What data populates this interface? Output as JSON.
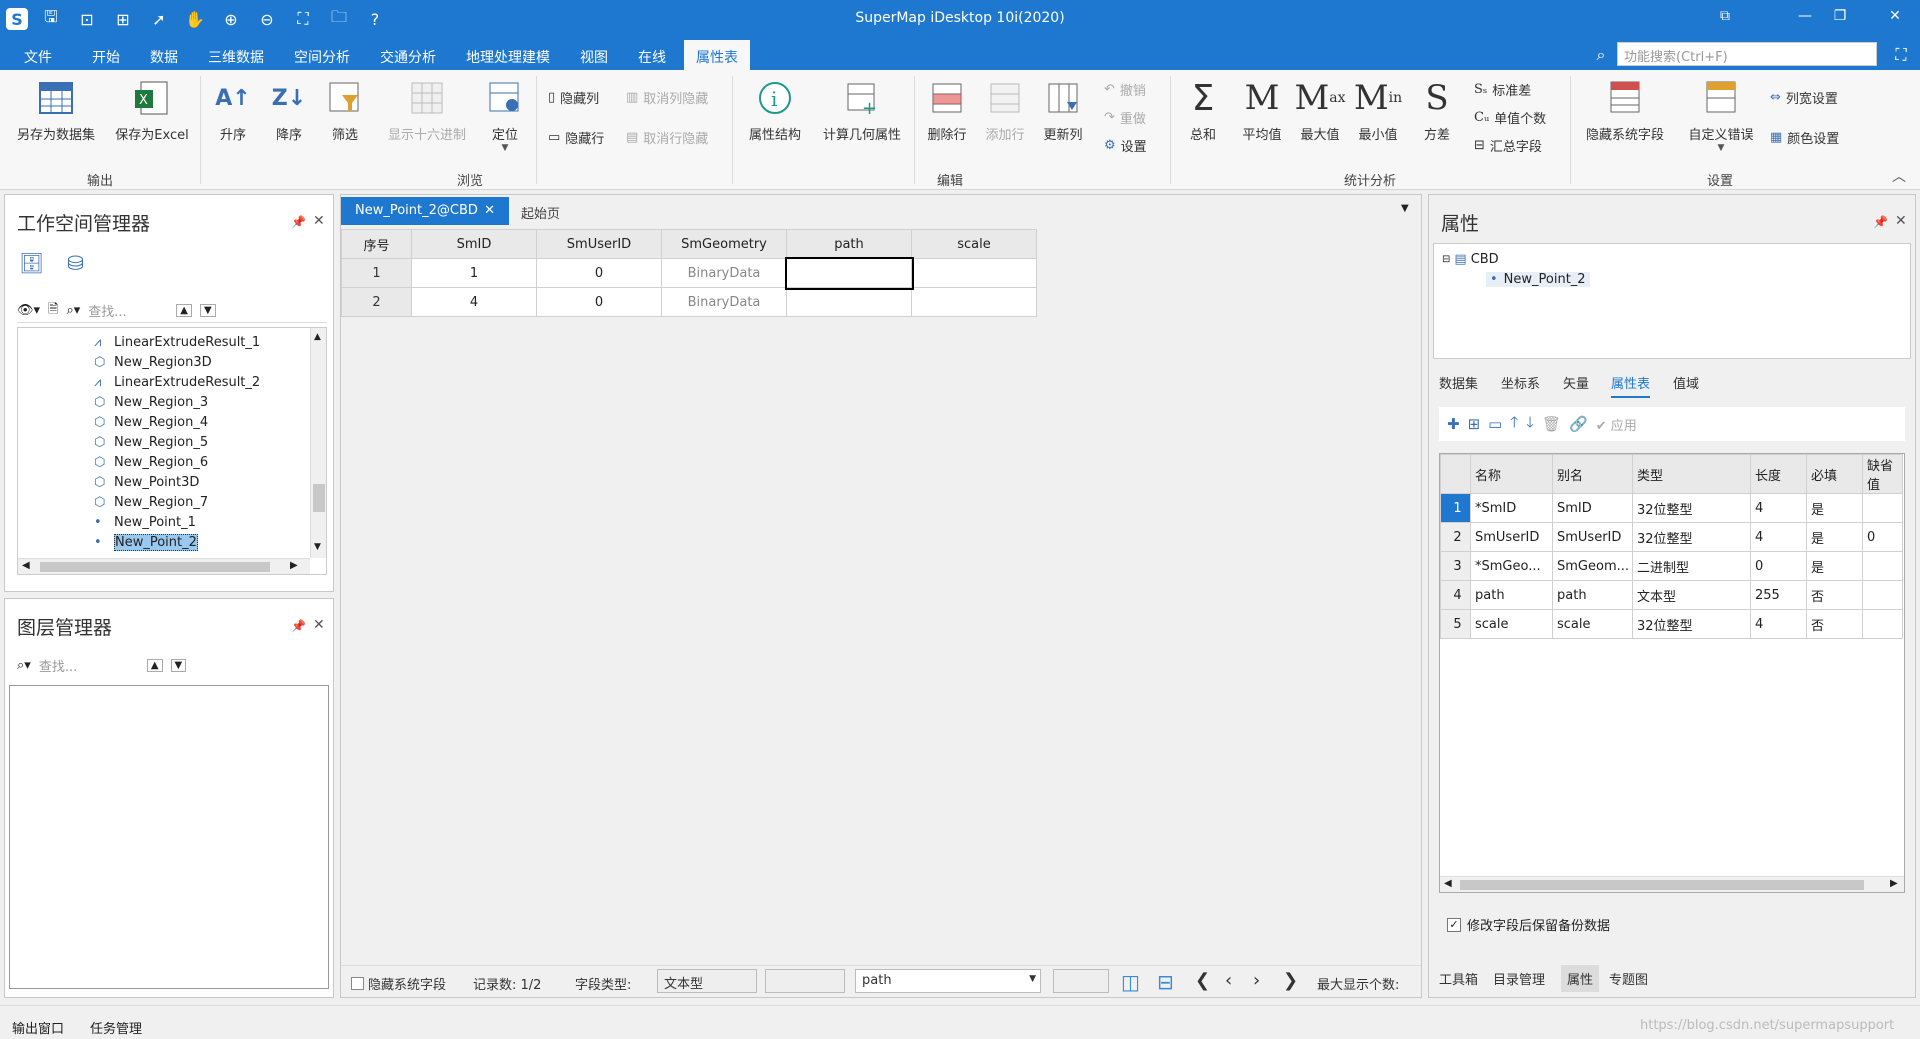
{
  "app_title": "SuperMap iDesktop 10i(2020)",
  "menus": [
    "文件",
    "开始",
    "数据",
    "三维数据",
    "空间分析",
    "交通分析",
    "地理处理建模",
    "视图",
    "在线",
    "属性表"
  ],
  "search_placeholder": "功能搜索(Ctrl+F)",
  "ribbon": {
    "save_dataset": "另存为数据集",
    "save_excel": "保存为Excel",
    "group_output": "输出",
    "asc": "升序",
    "desc": "降序",
    "filter": "筛选",
    "hex": "显示十六进制",
    "locate": "定位",
    "hide_col": "隐藏列",
    "unhide_col": "取消列隐藏",
    "hide_row": "隐藏行",
    "unhide_row": "取消行隐藏",
    "group_browse": "浏览",
    "attr_struct": "属性结构",
    "calc_geom": "计算几何属性",
    "del_row": "删除行",
    "add_row": "添加行",
    "update_col": "更新列",
    "undo": "撤销",
    "redo": "重做",
    "settings": "设置",
    "group_edit": "编辑",
    "sum": "总和",
    "avg": "平均值",
    "max": "最大值",
    "min": "最小值",
    "variance": "方差",
    "stddev": "标准差",
    "unique": "单值个数",
    "summary": "汇总字段",
    "group_stats": "统计分析",
    "hide_sys": "隐藏系统字段",
    "custom_err": "自定义错误",
    "col_width": "列宽设置",
    "color_set": "颜色设置",
    "group_settings": "设置"
  },
  "workspace": {
    "title": "工作空间管理器",
    "search_placeholder": "查找...",
    "items": [
      "LinearExtrudeResult_1",
      "New_Region3D",
      "LinearExtrudeResult_2",
      "New_Region_3",
      "New_Region_4",
      "New_Region_5",
      "New_Region_6",
      "New_Point3D",
      "New_Region_7",
      "New_Point_1",
      "New_Point_2"
    ]
  },
  "layers": {
    "title": "图层管理器",
    "search_placeholder": "查找..."
  },
  "doc_tabs": [
    "New_Point_2@CBD",
    "起始页"
  ],
  "table": {
    "headers": [
      "序号",
      "SmID",
      "SmUserID",
      "SmGeometry",
      "path",
      "scale"
    ],
    "rows": [
      [
        "1",
        "1",
        "0",
        "BinaryData",
        "",
        ""
      ],
      [
        "2",
        "4",
        "0",
        "BinaryData",
        "",
        ""
      ]
    ]
  },
  "bottom": {
    "hide_sys": "隐藏系统字段",
    "records": "记录数:  1/2",
    "field_type_label": "字段类型:",
    "field_type_value": "文本型",
    "field_name": "path",
    "max_display": "最大显示个数:"
  },
  "props": {
    "title": "属性",
    "tree_root": "CBD",
    "tree_child": "New_Point_2",
    "tabs": [
      "数据集",
      "坐标系",
      "矢量",
      "属性表",
      "值域"
    ],
    "apply": "应用",
    "headers": [
      "名称",
      "别名",
      "类型",
      "长度",
      "必填",
      "缺省值"
    ],
    "rows": [
      [
        "1",
        "*SmID",
        "SmID",
        "32位整型",
        "4",
        "是",
        ""
      ],
      [
        "2",
        "SmUserID",
        "SmUserID",
        "32位整型",
        "4",
        "是",
        "0"
      ],
      [
        "3",
        "*SmGeo...",
        "SmGeom...",
        "二进制型",
        "0",
        "是",
        ""
      ],
      [
        "4",
        "path",
        "path",
        "文本型",
        "255",
        "否",
        ""
      ],
      [
        "5",
        "scale",
        "scale",
        "32位整型",
        "4",
        "否",
        ""
      ]
    ],
    "backup_label": "修改字段后保留备份数据",
    "bottom_tabs": [
      "工具箱",
      "目录管理",
      "属性",
      "专题图"
    ]
  },
  "status_tabs": [
    "输出窗口",
    "任务管理"
  ],
  "watermark": "https://blog.csdn.net/supermapsupport"
}
